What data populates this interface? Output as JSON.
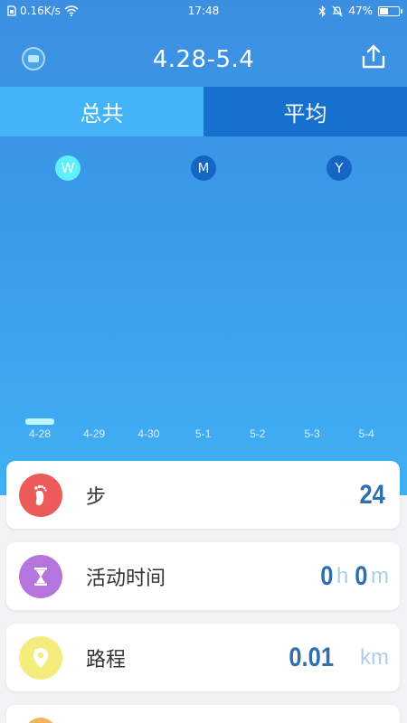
{
  "status_bar": {
    "network_speed": "0.16K/s",
    "time": "17:48",
    "battery_percent": "47%",
    "battery_level": 0.47
  },
  "header": {
    "title": "4.28-5.4"
  },
  "tabs": [
    {
      "label": "总共",
      "active": true
    },
    {
      "label": "平均",
      "active": false
    }
  ],
  "periods": [
    {
      "label": "W",
      "active": true
    },
    {
      "label": "M",
      "active": false
    },
    {
      "label": "Y",
      "active": false
    }
  ],
  "chart_data": {
    "type": "bar",
    "categories": [
      "4-28",
      "4-29",
      "4-30",
      "5-1",
      "5-2",
      "5-3",
      "5-4"
    ],
    "values": [
      24,
      0,
      0,
      0,
      0,
      0,
      0
    ]
  },
  "cards": [
    {
      "label": "步",
      "value": "24",
      "icon": "footprint-icon",
      "icon_color": "#ec5a5a"
    },
    {
      "label": "活动时间",
      "hours": "0",
      "hours_unit": "h",
      "minutes": "0",
      "minutes_unit": "m",
      "icon": "hourglass-icon",
      "icon_color": "#b675dc"
    },
    {
      "label": "路程",
      "value": "0.01",
      "unit": "km",
      "icon": "location-pin-icon",
      "icon_color": "#f4ec7c"
    }
  ],
  "colors": {
    "accent_tab": "#43b4f7",
    "inactive_tab": "#1670cd",
    "value_text": "#2f6fae"
  }
}
